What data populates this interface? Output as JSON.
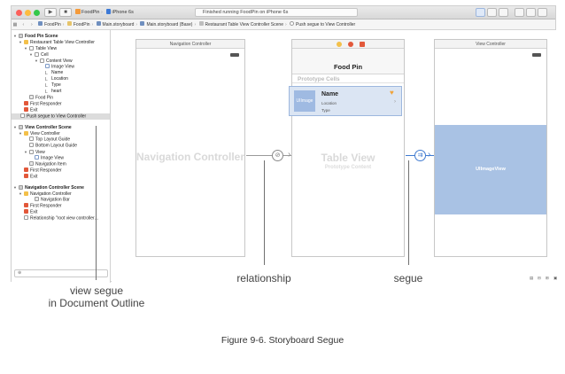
{
  "toolbar": {
    "scheme_project": "FoodPin",
    "scheme_device": "iPhone 6s",
    "status_text": "Finished running FoodPin on iPhone 6s"
  },
  "jumpbar": {
    "crumbs": [
      "FoodPin",
      "FoodPin",
      "Main.storyboard",
      "Main.storyboard (Base)",
      "Restaurant Table View Controller Scene",
      "Push segue to View Controller"
    ]
  },
  "outline": {
    "rows": [
      "Food Pin Scene",
      "Restaurant Table View Controller",
      "Table View",
      "Cell",
      "Content View",
      "Image View",
      "Name",
      "Location",
      "Type",
      "heart",
      "Food Pin",
      "First Responder",
      "Exit",
      "Push segue to View Controller",
      "View Controller Scene",
      "View Controller",
      "Top Layout Guide",
      "Bottom Layout Guide",
      "View",
      "Image View",
      "Navigation Item",
      "First Responder",
      "Exit",
      "Navigation Controller Scene",
      "Navigation Controller",
      "Navigation Bar",
      "First Responder",
      "Exit",
      "Relationship \"root view controller…"
    ]
  },
  "canvas": {
    "nav_scene_title": "Navigation Controller",
    "nav_scene_label": "Navigation Controller",
    "table_nav_title": "Food Pin",
    "prototype_cells": "Prototype Cells",
    "cell_image": "UIImage",
    "cell_name": "Name",
    "cell_location": "Location",
    "cell_type": "Type",
    "table_view_label": "Table View",
    "prototype_content": "Prototype Content",
    "vc_scene_title": "View Controller",
    "uiimageview": "UIImageView"
  },
  "callouts": {
    "view_segue": "view segue",
    "document_outline": "in Document Outline",
    "relationship": "relationship",
    "segue": "segue"
  },
  "caption": "Figure 9-6. Storyboard Segue",
  "colors": {
    "selection_blue": "#a9c2e4",
    "cell_highlight": "#dbe5f3",
    "segue_blue": "#3f7ad0"
  }
}
